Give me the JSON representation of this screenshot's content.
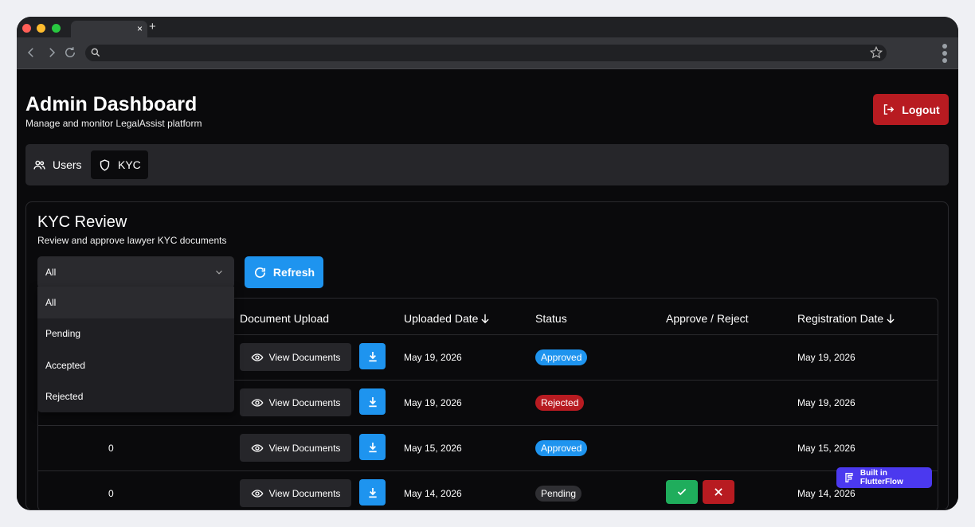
{
  "browser": {
    "tab_close": "×",
    "new_tab": "+",
    "colors": {
      "close": "#ff5f57",
      "minimize": "#febc2e",
      "maximize": "#28c840"
    }
  },
  "header": {
    "title": "Admin Dashboard",
    "subtitle": "Manage and monitor LegalAssist platform",
    "logout_label": "Logout"
  },
  "tabs": [
    {
      "label": "Users",
      "icon": "users-icon",
      "active": false
    },
    {
      "label": "KYC",
      "icon": "shield-icon",
      "active": true
    }
  ],
  "kyc": {
    "title": "KYC Review",
    "subtitle": "Review and approve lawyer KYC documents",
    "filter_value": "All",
    "refresh_label": "Refresh",
    "filter_options": [
      "All",
      "Pending",
      "Accepted",
      "Rejected"
    ],
    "columns": {
      "document_upload": "Document Upload",
      "uploaded_date": "Uploaded Date",
      "status": "Status",
      "approve_reject": "Approve / Reject",
      "registration_date": "Registration Date"
    },
    "rows": [
      {
        "count": "",
        "view_label": "View Documents",
        "uploaded_date": "May 19, 2026",
        "status": "Approved",
        "status_color": "#1e94ef",
        "registration_date": "May 19, 2026",
        "actions": false
      },
      {
        "count": "",
        "view_label": "View Documents",
        "uploaded_date": "May 19, 2026",
        "status": "Rejected",
        "status_color": "#b81b21",
        "registration_date": "May 19, 2026",
        "actions": false
      },
      {
        "count": "0",
        "view_label": "View Documents",
        "uploaded_date": "May 15, 2026",
        "status": "Approved",
        "status_color": "#1e94ef",
        "registration_date": "May 15, 2026",
        "actions": false
      },
      {
        "count": "0",
        "view_label": "View Documents",
        "uploaded_date": "May 14, 2026",
        "status": "Pending",
        "status_color": "#2f2f33",
        "registration_date": "May 14, 2026",
        "actions": true
      }
    ]
  },
  "flutterflow": {
    "label": "Built in FlutterFlow"
  }
}
